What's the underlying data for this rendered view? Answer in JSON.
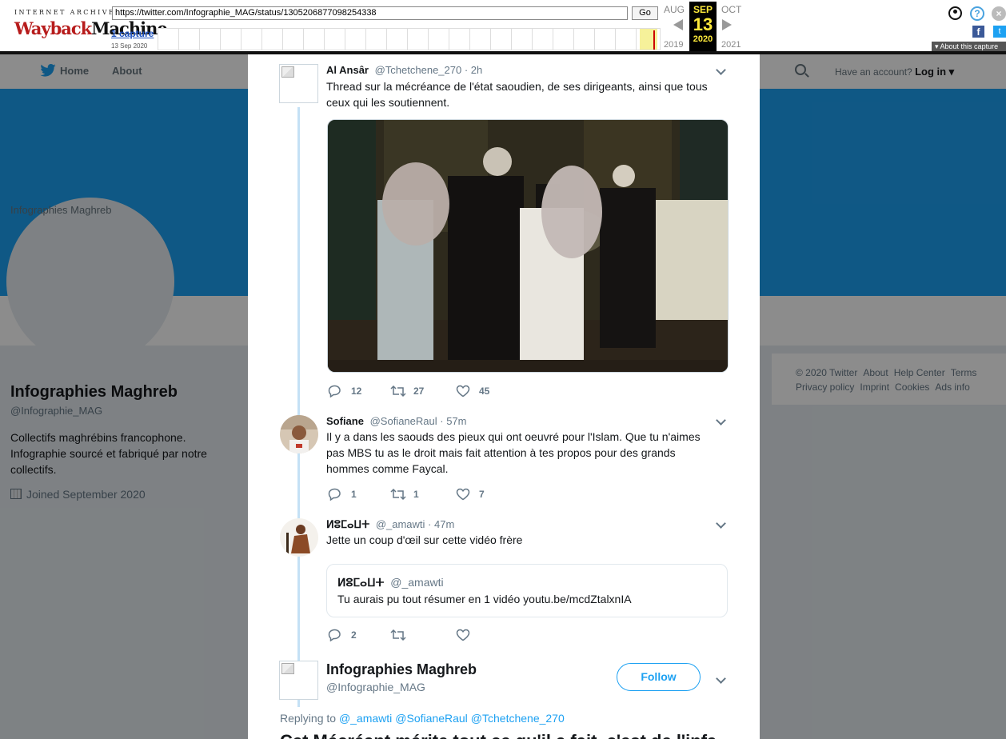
{
  "wayback": {
    "ia_text": "INTERNET ARCHIVE",
    "logo_red": "Wayback",
    "logo_black": "Machine",
    "url": "https://twitter.com/Infographie_MAG/status/1305206877098254338",
    "go_label": "Go",
    "captures": "1 capture",
    "capture_date": "13 Sep 2020",
    "prev_month": "AUG",
    "prev_year": "2019",
    "cur_month": "SEP",
    "cur_day": "13",
    "cur_year": "2020",
    "next_month": "OCT",
    "next_year": "2021",
    "about": "About this capture",
    "help_glyph": "?",
    "close_glyph": "×",
    "facebook_glyph": "f",
    "twitter_glyph": "t"
  },
  "twitter_nav": {
    "home_label": "Home",
    "about_label": "About",
    "account_text": "Have an account?",
    "login_label": "Log in ▾"
  },
  "profile": {
    "avatar_alt": "Infographies Maghreb",
    "name": "Infographies Maghreb",
    "handle": "@Infographie_MAG",
    "bio": "Collectifs maghrébins francophone. Infographie sourcé et fabriqué par notre collectifs.",
    "joined": "Joined September 2020"
  },
  "footer": {
    "links": [
      "© 2020 Twitter",
      "About",
      "Help Center",
      "Terms",
      "Privacy policy",
      "Imprint",
      "Cookies",
      "Ads info"
    ]
  },
  "tweets": [
    {
      "name": "Al Ansâr",
      "handle": "@Tchetchene_270",
      "time": "· 2h",
      "text": "Thread sur la mécréance de l'état saoudien, de ses dirigeants, ainsi que tous ceux qui les soutiennent.",
      "replies": "12",
      "retweets": "27",
      "likes": "45"
    },
    {
      "name": "Sofiane",
      "handle": "@SofianeRaul",
      "time": "· 57m",
      "text": "Il y a dans les saouds des pieux qui ont oeuvré pour l'Islam. Que tu n'aimes pas MBS tu as le droit mais fait attention à tes propos pour des grands hommes comme Faycal.",
      "replies": "1",
      "retweets": "1",
      "likes": "7"
    },
    {
      "name": "ⵍⵓⵎⴰⵡⵜ",
      "handle": "@_amawti",
      "time": "· 47m",
      "text": "Jette un coup d'œil sur cette vidéo frère",
      "replies": "2",
      "retweets": "",
      "likes": ""
    }
  ],
  "quote": {
    "name": "ⵍⵓⵎⴰⵡⵜ",
    "handle": "@_amawti",
    "text": "Tu aurais pu tout résumer en 1 vidéo youtu.be/mcdZtalxnIA"
  },
  "main_tweet": {
    "name": "Infographies Maghreb",
    "handle": "@Infographie_MAG",
    "follow_label": "Follow",
    "replying_to": "Replying to",
    "reply_handles": [
      "@_amawti",
      "@SofianeRaul",
      "@Tchetchene_270"
    ],
    "cut_text": "Cet Mécréant mérite tout ce qu'il a fait, c'est de l'infa"
  },
  "colors": {
    "twitter_blue": "#1da1f2",
    "thread_line": "#c4e1f5",
    "wayback_highlight": "#ffeb3b"
  }
}
